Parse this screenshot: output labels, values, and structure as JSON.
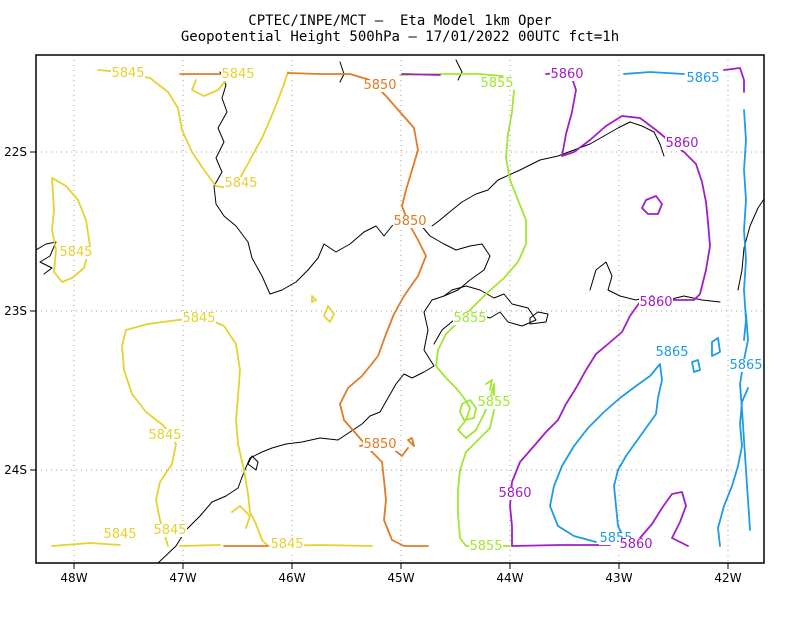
{
  "title": {
    "line1": "CPTEC/INPE/MCT –  Eta Model 1km Oper",
    "line2": "Geopotential Height 500hPa – 17/01/2022 00UTC fct=1h"
  },
  "axes": {
    "x_ticks": [
      "48W",
      "47W",
      "46W",
      "45W",
      "44W",
      "43W",
      "42W"
    ],
    "y_ticks": [
      "22S",
      "23S",
      "24S"
    ]
  },
  "contour_levels": [
    {
      "level": "5845",
      "color": "#e6d22e"
    },
    {
      "level": "5850",
      "color": "#e07b26"
    },
    {
      "level": "5855",
      "color": "#a0e632"
    },
    {
      "level": "5860",
      "color": "#a01ec8"
    },
    {
      "level": "5865",
      "color": "#1e9be6"
    }
  ],
  "contour_labels": [
    {
      "text": "5845",
      "color": "#e6d22e"
    },
    {
      "text": "5845",
      "color": "#e6d22e"
    },
    {
      "text": "5845",
      "color": "#e6d22e"
    },
    {
      "text": "5845",
      "color": "#e6d22e"
    },
    {
      "text": "5845",
      "color": "#e6d22e"
    },
    {
      "text": "5845",
      "color": "#e6d22e"
    },
    {
      "text": "5845",
      "color": "#e6d22e"
    },
    {
      "text": "5845",
      "color": "#e6d22e"
    },
    {
      "text": "5845",
      "color": "#e6d22e"
    },
    {
      "text": "5850",
      "color": "#e07b26"
    },
    {
      "text": "5850",
      "color": "#e07b26"
    },
    {
      "text": "5850",
      "color": "#e07b26"
    },
    {
      "text": "5855",
      "color": "#a0e632"
    },
    {
      "text": "5855",
      "color": "#a0e632"
    },
    {
      "text": "5855",
      "color": "#a0e632"
    },
    {
      "text": "5855",
      "color": "#a0e632"
    },
    {
      "text": "5855",
      "color": "#1e9be6"
    },
    {
      "text": "5860",
      "color": "#a01ec8"
    },
    {
      "text": "5860",
      "color": "#a01ec8"
    },
    {
      "text": "5860",
      "color": "#a01ec8"
    },
    {
      "text": "5860",
      "color": "#a01ec8"
    },
    {
      "text": "5860",
      "color": "#a01ec8"
    },
    {
      "text": "5865",
      "color": "#1e9be6"
    },
    {
      "text": "5865",
      "color": "#1e9be6"
    },
    {
      "text": "5865",
      "color": "#1e9be6"
    }
  ]
}
